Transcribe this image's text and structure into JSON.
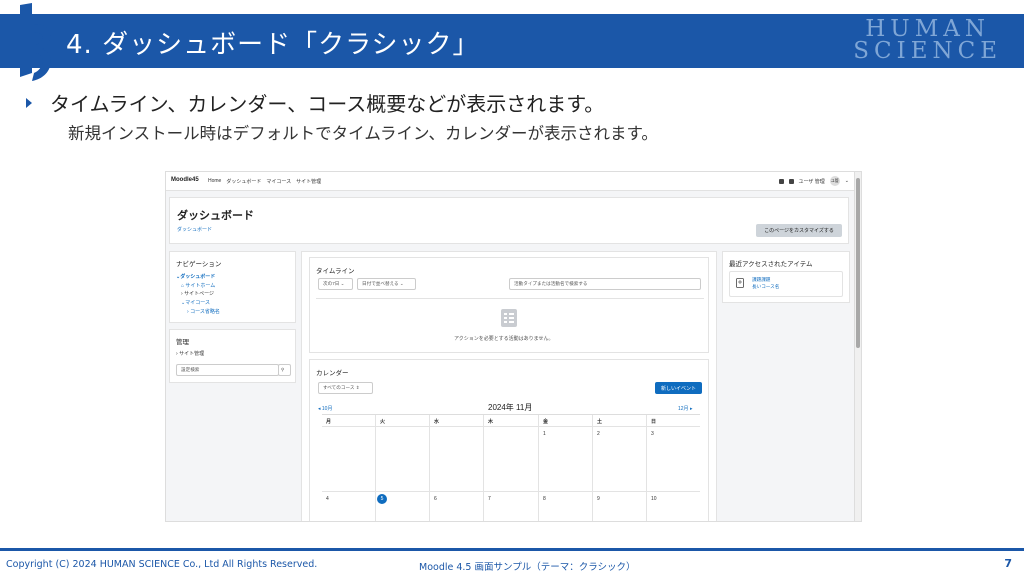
{
  "slide": {
    "title": "4. ダッシュボード「クラシック」",
    "brand_line1": "HUMAN",
    "brand_line2": "SCIENCE",
    "bullet": "タイムライン、カレンダー、コース概要などが表示されます。",
    "sub": "新規インストール時はデフォルトでタイムライン、カレンダーが表示されます。",
    "footer_left": "Copyright (C) 2024 HUMAN SCIENCE Co., Ltd All Rights Reserved.",
    "footer_mid": "Moodle 4.5 画面サンプル（テーマ：クラシック）",
    "page_number": "7",
    "colors": {
      "brand_blue": "#1b57a8",
      "moodle_blue": "#0f6cbf"
    }
  },
  "moodle": {
    "brand": "Moodle45",
    "nav_links": [
      "Home",
      "ダッシュボード",
      "マイコース",
      "サイト管理"
    ],
    "user_menu": "ユーザ 管理",
    "avatar_initials": "ユ管",
    "page_heading": "ダッシュボード",
    "breadcrumb": "ダッシュボード",
    "customize_button": "このページをカスタマイズする",
    "navigation": {
      "title": "ナビゲーション",
      "items": [
        "ダッシュボード",
        "サイトホーム",
        "サイトページ",
        "マイコース",
        "コース省略名"
      ]
    },
    "admin": {
      "title": "管理",
      "item": "サイト管理",
      "search_placeholder": "設定検索"
    },
    "timeline": {
      "title": "タイムライン",
      "filter_dropdown": "次の7日",
      "sort_dropdown": "日付で並べ替える",
      "search_placeholder": "活動タイプまたは活動名で検索する",
      "empty_message": "アクションを必要とする活動はありません。"
    },
    "calendar": {
      "title": "カレンダー",
      "course_select": "すべてのコース",
      "new_event_button": "新しいイベント",
      "prev_month": "10月",
      "current_month": "2024年 11月",
      "next_month": "12月",
      "weekdays": [
        "月",
        "火",
        "水",
        "木",
        "金",
        "土",
        "日"
      ],
      "row1": [
        "",
        "",
        "",
        "",
        "1",
        "2",
        "3"
      ],
      "row2": [
        "4",
        "5",
        "6",
        "7",
        "8",
        "9",
        "10"
      ],
      "today": "5"
    },
    "recent_items": {
      "title": "最近アクセスされたアイテム",
      "item_line1": "課題課題",
      "item_line2": "長いコース名"
    }
  }
}
